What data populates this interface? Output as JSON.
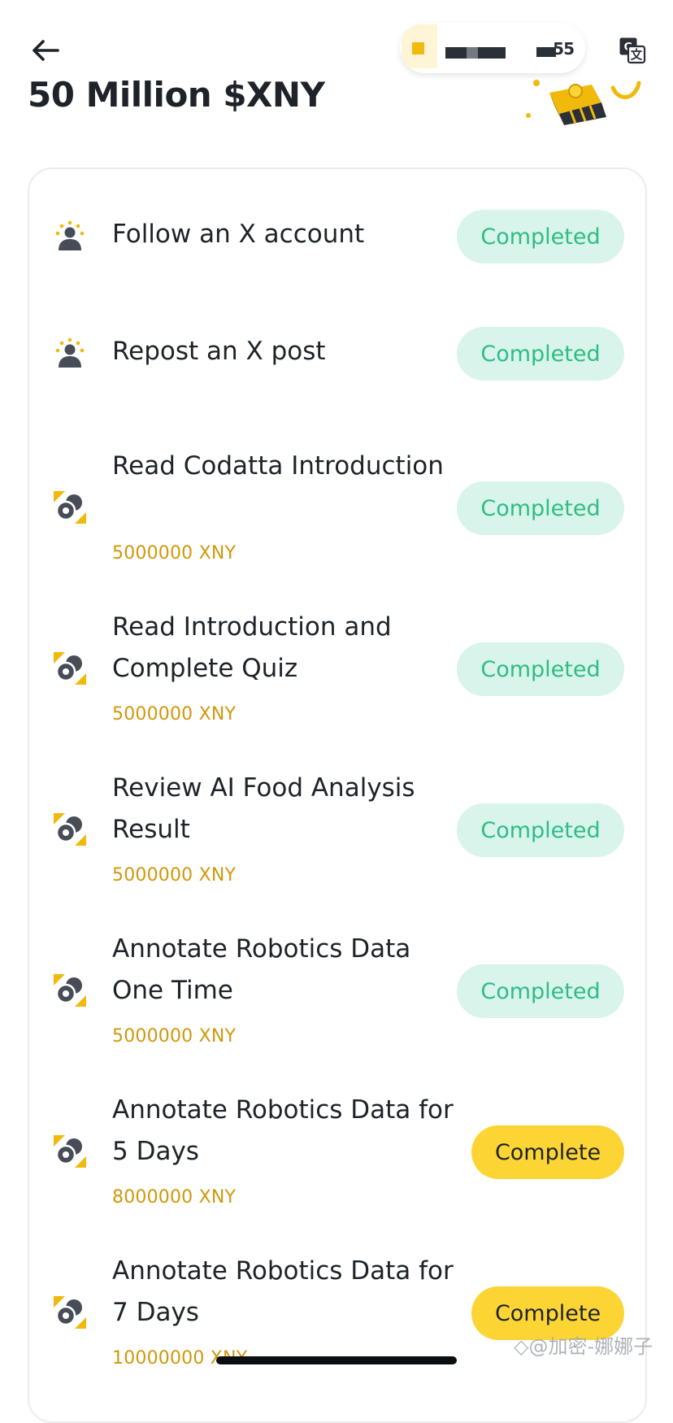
{
  "header": {
    "back_icon": "arrow-left-icon",
    "account_chip_value": "▬55",
    "translate_icon": "translate-icon",
    "title": "50 Million $XNY"
  },
  "colors": {
    "completed_bg": "#d9f4ea",
    "completed_text": "#2ebd85",
    "complete_bg": "#fcd535",
    "reward_text": "#d0980b",
    "brand_yellow": "#f0b90b",
    "icon_dark": "#474d57"
  },
  "tasks": [
    {
      "title": "Follow an X account",
      "reward": "",
      "icon": "people-icon",
      "status": "Completed"
    },
    {
      "title": "Repost an X post",
      "reward": "",
      "icon": "people-icon",
      "status": "Completed"
    },
    {
      "title": "Read Codatta Introduction",
      "reward": "5000000 XNY",
      "icon": "token-icon",
      "status": "Completed"
    },
    {
      "title": "Read Introduction and Complete Quiz",
      "reward": "5000000 XNY",
      "icon": "token-icon",
      "status": "Completed"
    },
    {
      "title": "Review AI Food Analysis Result",
      "reward": "5000000 XNY",
      "icon": "token-icon",
      "status": "Completed"
    },
    {
      "title": "Annotate Robotics Data One Time",
      "reward": "5000000 XNY",
      "icon": "token-icon",
      "status": "Completed"
    },
    {
      "title": "Annotate Robotics Data for 5 Days",
      "reward": "8000000 XNY",
      "icon": "token-icon",
      "status": "Complete"
    },
    {
      "title": "Annotate Robotics Data for 7 Days",
      "reward": "10000000 XNY",
      "icon": "token-icon",
      "status": "Complete"
    }
  ],
  "watermark": "◇@加密-娜娜子"
}
